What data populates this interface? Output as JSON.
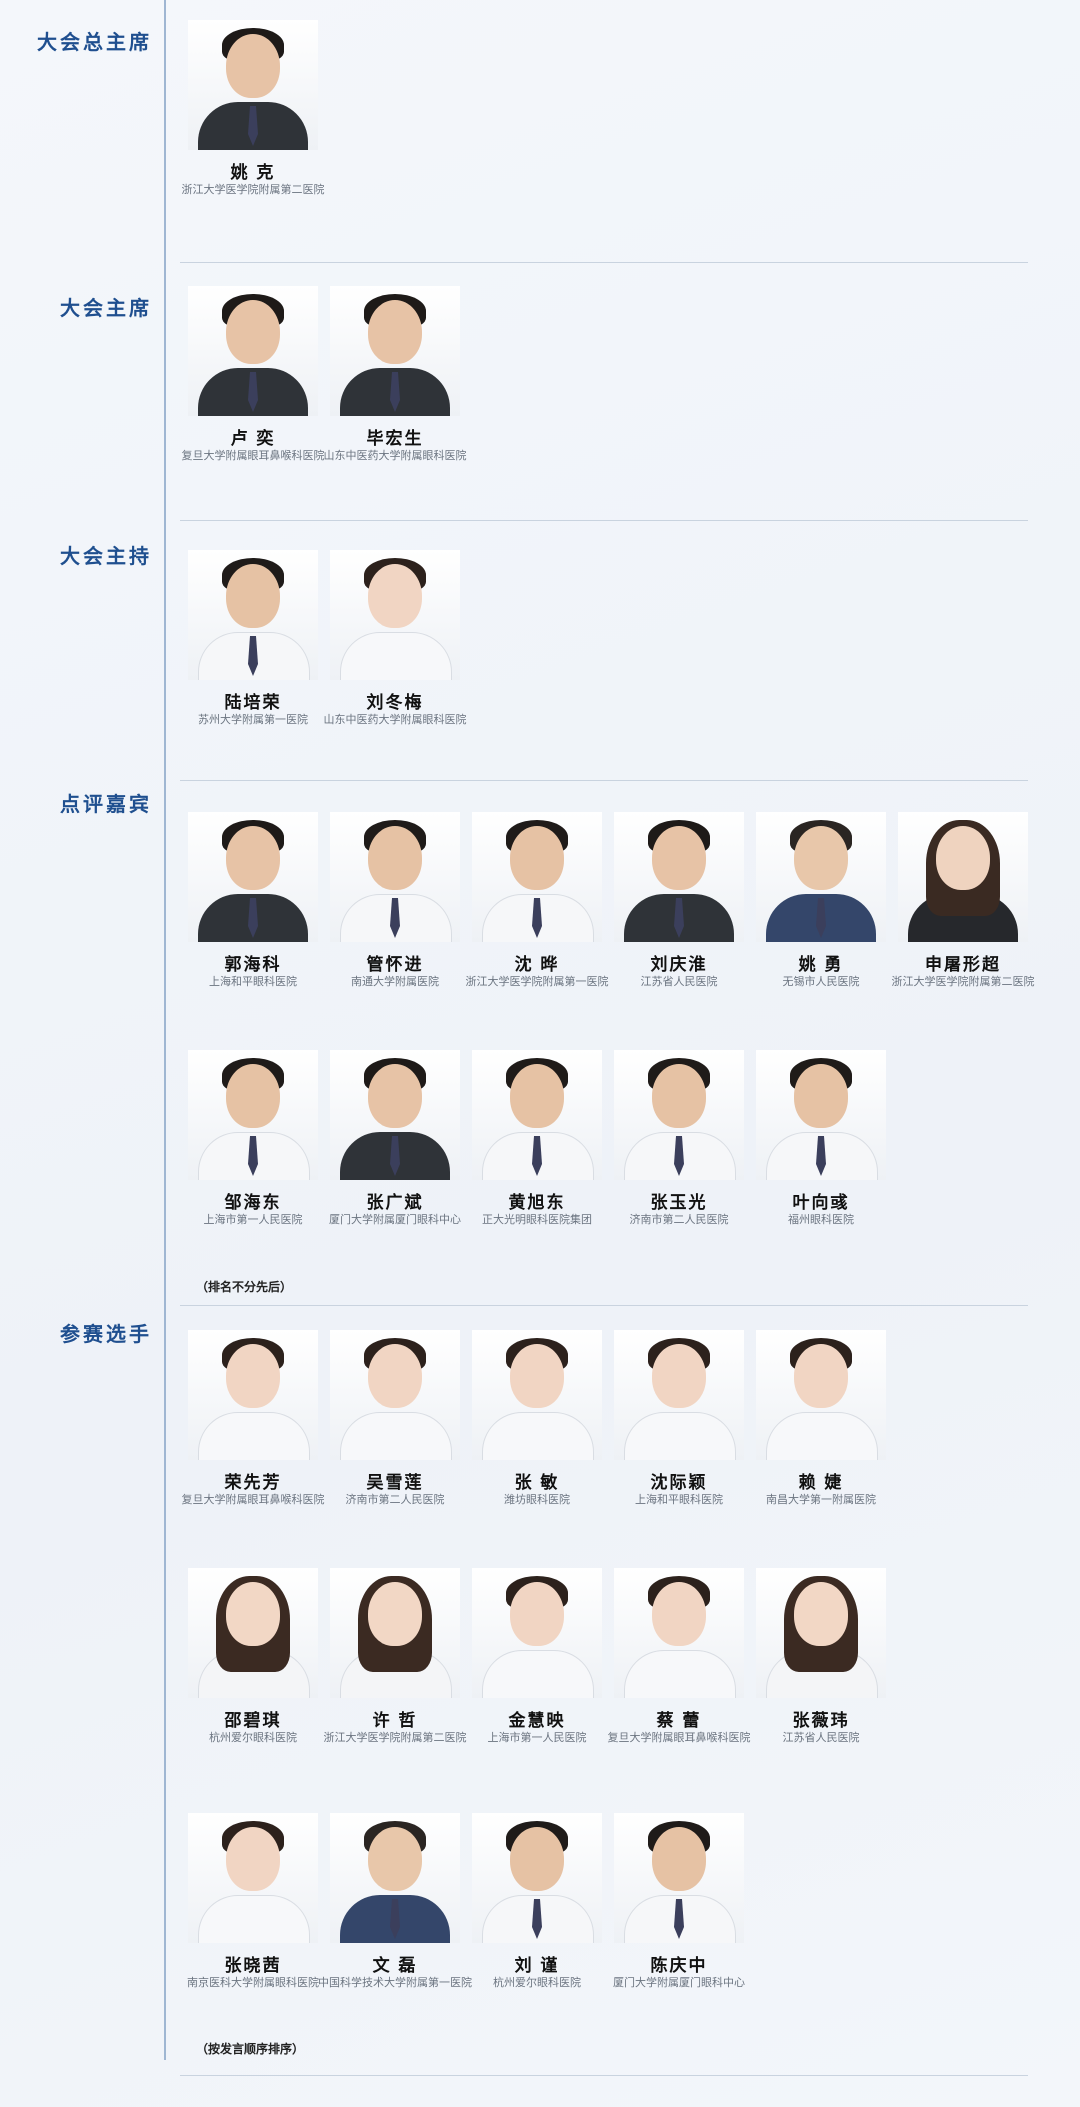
{
  "sections": [
    {
      "title": "大会总主席",
      "people": [
        {
          "name": "姚 克",
          "hospital": "浙江大学医学院附属第二医院",
          "look": "suit"
        }
      ]
    },
    {
      "title": "大会主席",
      "people": [
        {
          "name": "卢 奕",
          "hospital": "复旦大学附属眼耳鼻喉科医院",
          "look": "suit"
        },
        {
          "name": "毕宏生",
          "hospital": "山东中医药大学附属眼科医院",
          "look": "suit"
        }
      ]
    },
    {
      "title": "大会主持",
      "people": [
        {
          "name": "陆培荣",
          "hospital": "苏州大学附属第一医院",
          "look": "coat"
        },
        {
          "name": "刘冬梅",
          "hospital": "山东中医药大学附属眼科医院",
          "look": "coat-f"
        }
      ]
    },
    {
      "title": "点评嘉宾",
      "rows": [
        [
          {
            "name": "郭海科",
            "hospital": "上海和平眼科医院",
            "look": "suit"
          },
          {
            "name": "管怀进",
            "hospital": "南通大学附属医院",
            "look": "coat"
          },
          {
            "name": "沈 晔",
            "hospital": "浙江大学医学院附属第一医院",
            "look": "coat"
          },
          {
            "name": "刘庆淮",
            "hospital": "江苏省人民医院",
            "look": "suit"
          },
          {
            "name": "姚 勇",
            "hospital": "无锡市人民医院",
            "look": "suit-blue"
          },
          {
            "name": "申屠形超",
            "hospital": "浙江大学医学院附属第二医院",
            "look": "suit-f"
          }
        ],
        [
          {
            "name": "邹海东",
            "hospital": "上海市第一人民医院",
            "look": "coat"
          },
          {
            "name": "张广斌",
            "hospital": "厦门大学附属厦门眼科中心",
            "look": "suit"
          },
          {
            "name": "黄旭东",
            "hospital": "正大光明眼科医院集团",
            "look": "coat"
          },
          {
            "name": "张玉光",
            "hospital": "济南市第二人民医院",
            "look": "coat"
          },
          {
            "name": "叶向彧",
            "hospital": "福州眼科医院",
            "look": "coat"
          }
        ]
      ],
      "note": "（排名不分先后）"
    },
    {
      "title": "参赛选手",
      "rows": [
        [
          {
            "name": "荣先芳",
            "hospital": "复旦大学附属眼耳鼻喉科医院",
            "look": "coat-f"
          },
          {
            "name": "吴雪莲",
            "hospital": "济南市第二人民医院",
            "look": "coat-f"
          },
          {
            "name": "张 敏",
            "hospital": "潍坊眼科医院",
            "look": "coat-f"
          },
          {
            "name": "沈际颖",
            "hospital": "上海和平眼科医院",
            "look": "coat-f"
          },
          {
            "name": "赖 婕",
            "hospital": "南昌大学第一附属医院",
            "look": "coat-f"
          }
        ],
        [
          {
            "name": "邵碧琪",
            "hospital": "杭州爱尔眼科医院",
            "look": "long-f"
          },
          {
            "name": "许 哲",
            "hospital": "浙江大学医学院附属第二医院",
            "look": "long-f"
          },
          {
            "name": "金慧映",
            "hospital": "上海市第一人民医院",
            "look": "coat-f"
          },
          {
            "name": "蔡 蕾",
            "hospital": "复旦大学附属眼耳鼻喉科医院",
            "look": "coat-f"
          },
          {
            "name": "张薇玮",
            "hospital": "江苏省人民医院",
            "look": "long-f"
          }
        ],
        [
          {
            "name": "张晓茜",
            "hospital": "南京医科大学附属眼科医院",
            "look": "coat-f"
          },
          {
            "name": "文 磊",
            "hospital": "中国科学技术大学附属第一医院",
            "look": "suit-blue"
          },
          {
            "name": "刘 谨",
            "hospital": "杭州爱尔眼科医院",
            "look": "coat"
          },
          {
            "name": "陈庆中",
            "hospital": "厦门大学附属厦门眼科中心",
            "look": "coat"
          }
        ]
      ],
      "note": "（按发言顺序排序）"
    }
  ]
}
